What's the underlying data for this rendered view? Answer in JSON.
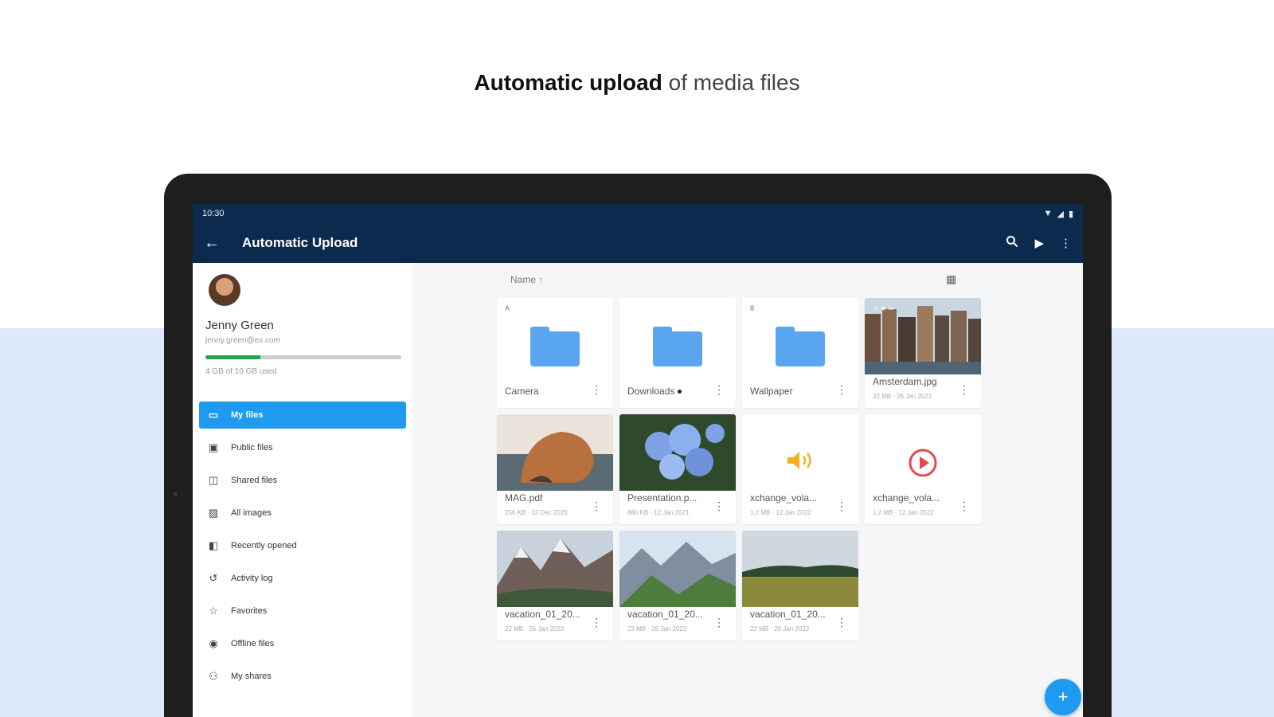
{
  "promo": {
    "title_strong": "Automatic upload",
    "title_rest": " of media files"
  },
  "statusbar": {
    "time": "10:30"
  },
  "appbar": {
    "title": "Automatic Upload",
    "back_icon": "arrow-left-icon",
    "search_icon": "search-icon",
    "play_icon": "play-icon",
    "more_icon": "more-vert-icon"
  },
  "user": {
    "name": "Jenny Green",
    "email": "jenny.green@ex.com",
    "quota_text": "4 GB of 10 GB used",
    "quota_fraction": 0.28
  },
  "nav": {
    "items": [
      {
        "label": "My files",
        "icon": "folder-icon",
        "active": true
      },
      {
        "label": "Public files",
        "icon": "public-folder-icon"
      },
      {
        "label": "Shared files",
        "icon": "shared-folder-icon"
      },
      {
        "label": "All images",
        "icon": "image-icon"
      },
      {
        "label": "Recently opened",
        "icon": "recent-file-icon"
      },
      {
        "label": "Activity log",
        "icon": "history-icon"
      },
      {
        "label": "Favorites",
        "icon": "star-icon"
      },
      {
        "label": "Offline files",
        "icon": "offline-icon"
      },
      {
        "label": "My shares",
        "icon": "shares-icon"
      }
    ]
  },
  "content": {
    "sort_label": "Name ↑",
    "view_toggle_icon": "grid-view-icon"
  },
  "files": [
    {
      "name": "Camera",
      "type": "folder",
      "badge": "A"
    },
    {
      "name": "Downloads",
      "type": "folder",
      "synced": true
    },
    {
      "name": "Wallpaper",
      "type": "folder",
      "badge": "8"
    },
    {
      "name": "Amsterdam.jpg",
      "type": "image",
      "meta": "22 MB · 26 Jan 2021",
      "badge": "♫ ★ ∞"
    },
    {
      "name": "MAG.pdf",
      "type": "image",
      "meta": "256 KB · 12 Dec 2020"
    },
    {
      "name": "Presentation.p...",
      "type": "image",
      "meta": "880 KB · 12 Jan 2021"
    },
    {
      "name": "xchange_vola...",
      "type": "audio",
      "meta": "1.2 MB · 12 Jan 2022"
    },
    {
      "name": "xchange_vola...",
      "type": "video",
      "meta": "1.2 MB · 12 Jan 2022"
    },
    {
      "name": "vacation_01_20...",
      "type": "image",
      "meta": "22 MB · 26 Jan 2022"
    },
    {
      "name": "vacation_01_20...",
      "type": "image",
      "meta": "22 MB · 26 Jan 2022"
    },
    {
      "name": "vacation_01_20...",
      "type": "image",
      "meta": "22 MB · 26 Jan 2022"
    }
  ],
  "fab": {
    "label": "+"
  }
}
